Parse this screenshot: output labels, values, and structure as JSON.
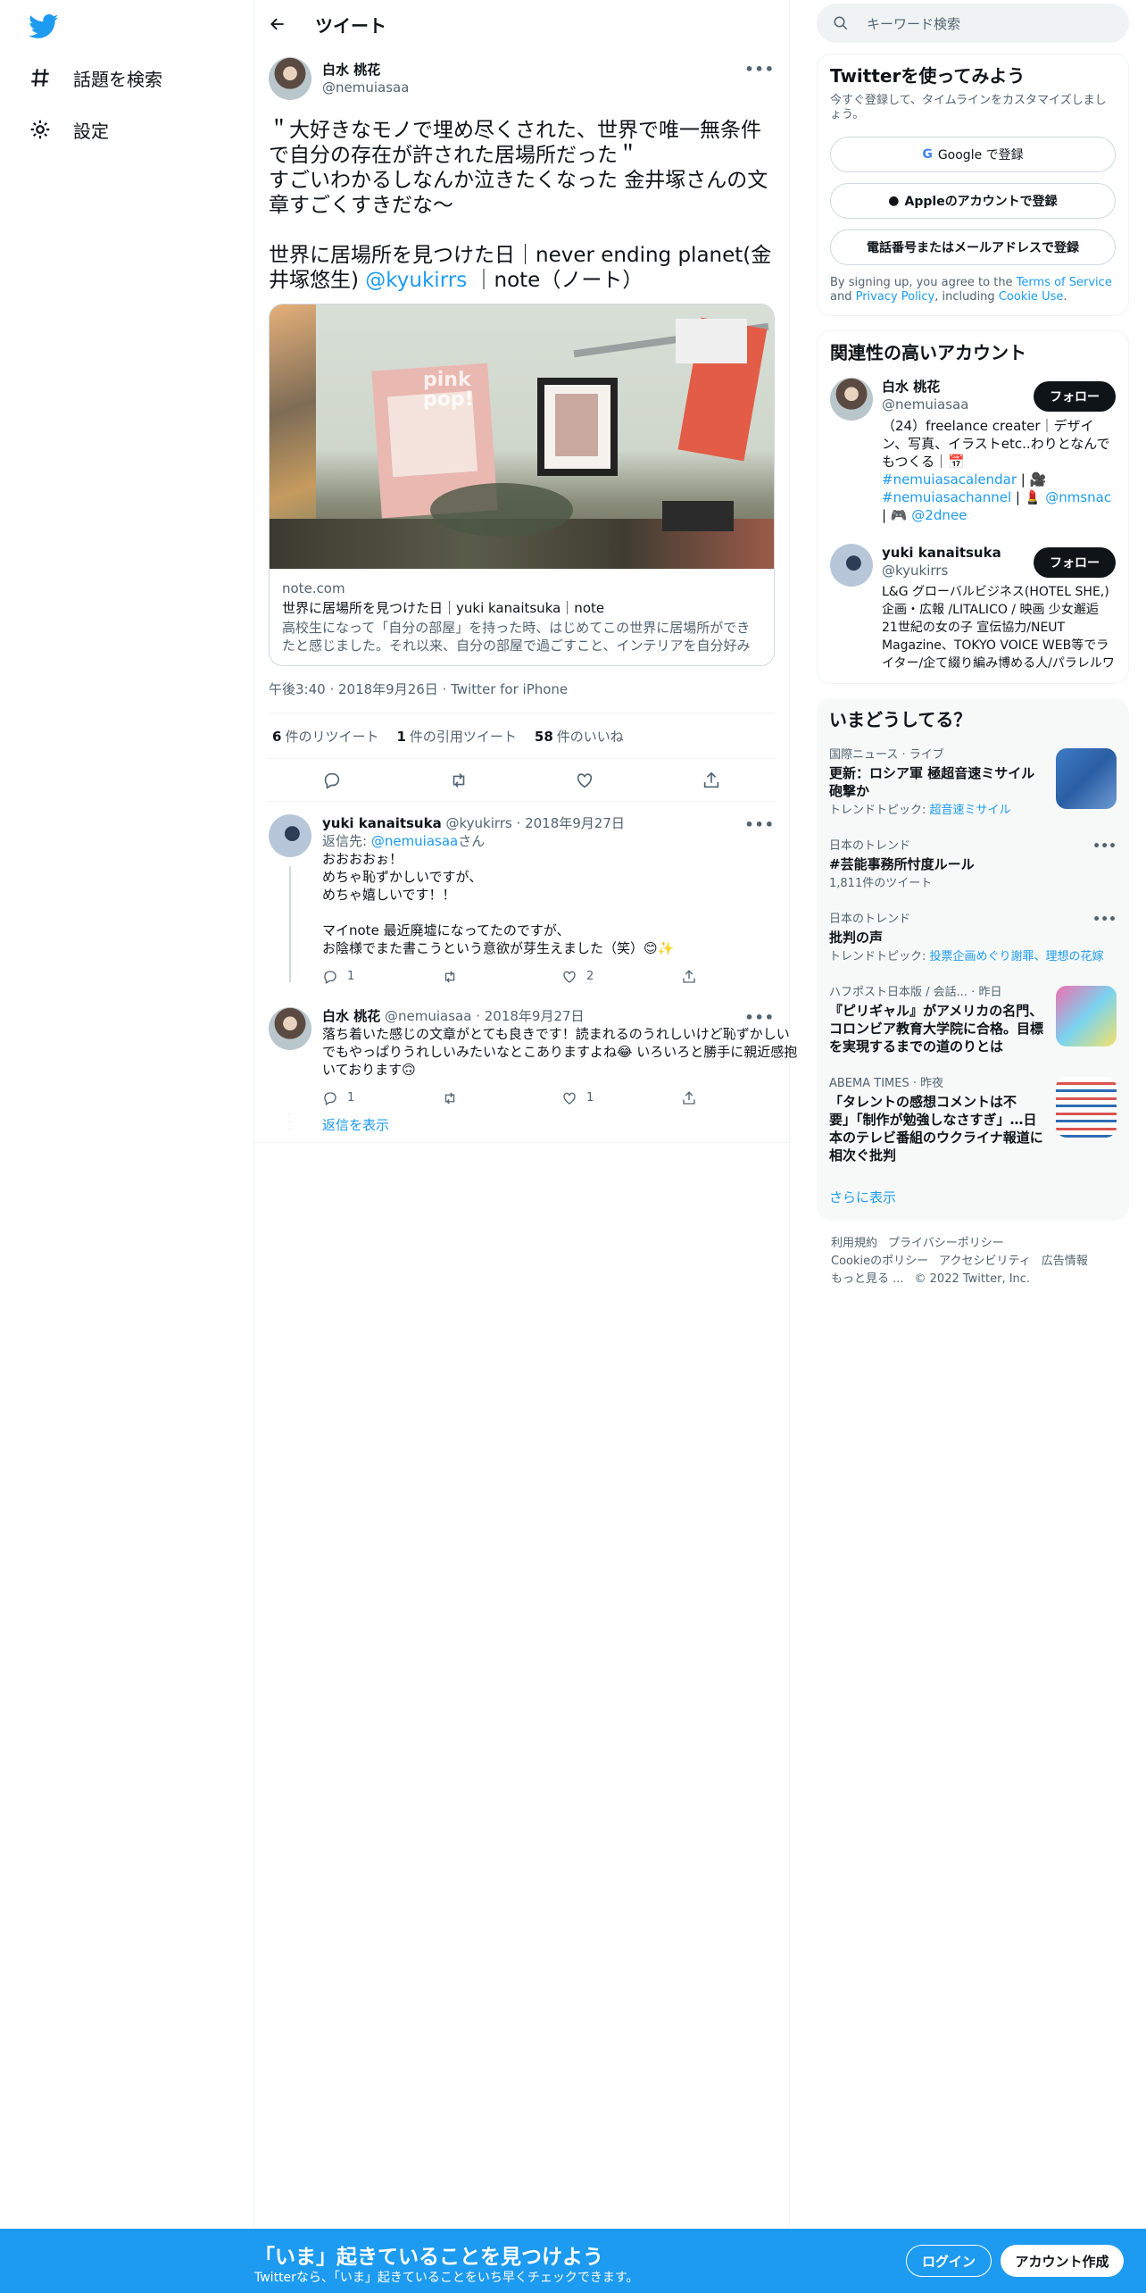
{
  "nav": {
    "explore_label": "話題を検索",
    "settings_label": "設定"
  },
  "header": {
    "title": "ツイート"
  },
  "tweet": {
    "author_name": "白水 桃花",
    "author_handle": "@nemuiasaa",
    "text_line1": "＂大好きなモノで埋め尽くされた、世界で唯一無条件で自分の存在が許された居場所だった＂\nすごいわかるしなんか泣きたくなった 金井塚さんの文章すごくすきだな〜\n\n世界に居場所を見つけた日｜never ending planet(金井塚悠生) ",
    "mention": "@kyukirrs",
    "text_line2": "｜note（ノート）",
    "card": {
      "domain": "note.com",
      "title": "世界に居場所を見つけた日｜yuki kanaitsuka｜note",
      "description": "高校生になって「自分の部屋」を持った時、はじめてこの世界に居場所ができたと感じました。それ以来、自分の部屋で過ごすこと、インテリアを自分好みに…",
      "image_text": "pink pop!"
    },
    "meta": "午後3:40 · 2018年9月26日 · Twitter for iPhone",
    "retweets_count": "6",
    "retweets_label": "件のリツイート",
    "quotes_count": "1",
    "quotes_label": "件の引用ツイート",
    "likes_count": "58",
    "likes_label": "件のいいね"
  },
  "replies": [
    {
      "name": "yuki kanaitsuka",
      "handle_date": "@kyukirrs · 2018年9月27日",
      "reply_to_label": "返信先: ",
      "reply_to_handle": "@nemuiasaa",
      "reply_to_suffix": "さん",
      "text": "おおおおぉ！\nめちゃ恥ずかしいですが、\nめちゃ嬉しいです！！\n\nマイnote 最近廃墟になってたのですが、\nお陰様でまた書こうという意欲が芽生えました（笑）😊✨",
      "reply_count": "1",
      "retweet_count": "",
      "like_count": "2"
    },
    {
      "name": "白水 桃花",
      "handle_date": "@nemuiasaa · 2018年9月27日",
      "text": "落ち着いた感じの文章がとても良きです！読まれるのうれしいけど恥ずかしいでもやっぱりうれしいみたいなとこありますよね😂 いろいろと勝手に親近感抱いております🙃",
      "reply_count": "1",
      "retweet_count": "",
      "like_count": "1"
    }
  ],
  "show_replies": "返信を表示",
  "search": {
    "placeholder": "キーワード検索"
  },
  "signup_panel": {
    "title": "Twitterを使ってみよう",
    "subtitle": "今すぐ登録して、タイムラインをカスタマイズしましょう。",
    "google_label": "Google で登録",
    "apple_label": "Appleのアカウントで登録",
    "phone_label": "電話番号またはメールアドレスで登録",
    "legal_prefix": "By signing up, you agree to the ",
    "terms": "Terms of Service",
    "legal_mid": " and ",
    "privacy": "Privacy Policy",
    "legal_mid2": ", including ",
    "cookie": "Cookie Use",
    "legal_end": "."
  },
  "related": {
    "title": "関連性の高いアカウント",
    "follow_label": "フォロー",
    "accounts": [
      {
        "name": "白水 桃花",
        "handle": "@nemuiasaa",
        "bio_text": "（24）freelance creater｜デザイン、写真、イラストetc..わりとなんでもつくる｜📅",
        "bio_tags": "#nemuiasacalendar",
        "bio_mid": " | 🎥 ",
        "bio_tags2": "#nemuiasachannel",
        "bio_mid2": " | 💄 ",
        "bio_mention": "@nmsnac",
        "bio_mid3": " | 🎮 ",
        "bio_mention2": "@2dnee"
      },
      {
        "name": "yuki kanaitsuka",
        "handle": "@kyukirrs",
        "bio_text": "L&G グローバルビジネス(HOTEL SHE,) 企画・広報 /LITALICO / 映画 少女邂逅 21世紀の女の子 宣伝協力/NEUT Magazine、TOKYO VOICE WEB等でライター/企て綴り編み博める人/パラレルワーカー←日販・CCC"
      }
    ]
  },
  "trends": {
    "title": "いまどうしてる？",
    "items": [
      {
        "category": "国際ニュース · ライブ",
        "title": "更新：ロシア軍 極超音速ミサイル砲撃か",
        "extra_label": "トレンドトピック: ",
        "extra_link": "超音速ミサイル"
      },
      {
        "category": "日本のトレンド",
        "title": "#芸能事務所忖度ルール",
        "extra_label": "1,811件のツイート",
        "extra_link": ""
      },
      {
        "category": "日本のトレンド",
        "title": "批判の声",
        "extra_label": "トレンドトピック: ",
        "extra_link": "投票企画めぐり謝罪、理想の花嫁"
      },
      {
        "category": "ハフポスト日本版 / 会話... · 昨日",
        "title": "『ピリギャル』がアメリカの名門、コロンビア教育大学院に合格。目標を実現するまでの道のりとは",
        "extra_label": "",
        "extra_link": ""
      },
      {
        "category": "ABEMA TIMES · 昨夜",
        "title": "「タレントの感想コメントは不要」「制作が勉強しなさすぎ」…日本のテレビ番組のウクライナ報道に相次ぐ批判",
        "extra_label": "",
        "extra_link": ""
      }
    ],
    "more": "さらに表示"
  },
  "footer": {
    "links": [
      "利用規約",
      "プライバシーポリシー",
      "Cookieのポリシー",
      "アクセシビリティ",
      "広告情報",
      "もっと見る ..."
    ],
    "copyright": "© 2022 Twitter, Inc."
  },
  "bottom_bar": {
    "title": "「いま」起きていることを見つけよう",
    "subtitle": "Twitterなら、「いま」起きていることをいち早くチェックできます。",
    "login": "ログイン",
    "signup": "アカウント作成"
  },
  "colors": {
    "accent": "#1d9bf0",
    "text": "#0f1419",
    "muted": "#536471"
  }
}
